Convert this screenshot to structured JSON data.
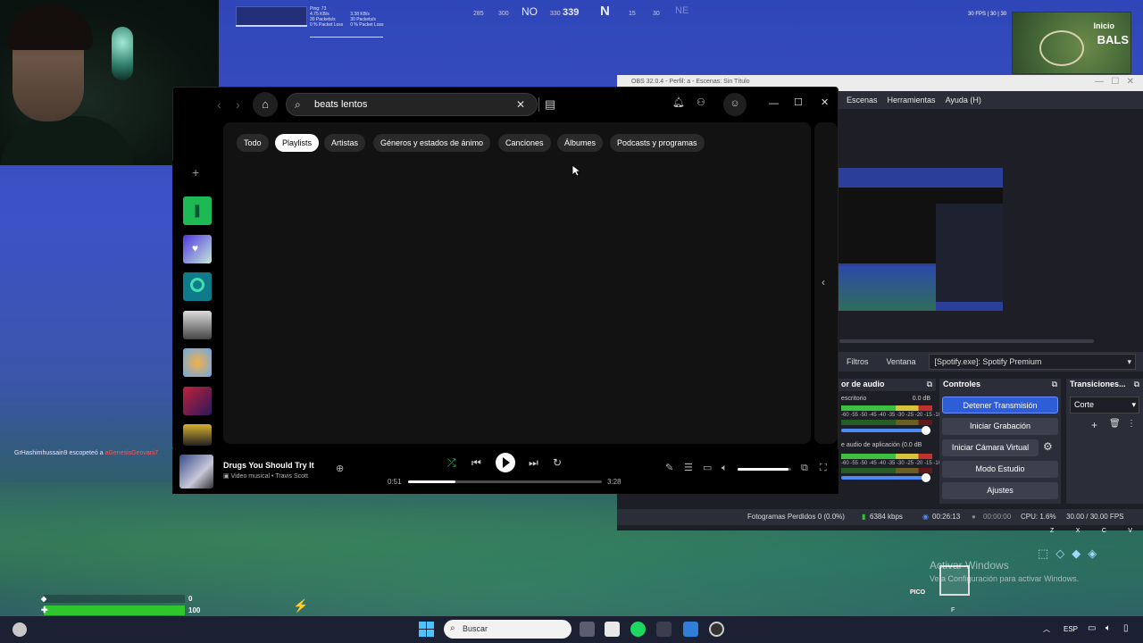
{
  "hud": {
    "net_stats": [
      "Ping: 73",
      "4.75 KB/s",
      "3.38 KB/s",
      "30 Packets/s",
      "30 Packets/s",
      "0 % Packet Loss",
      "0 % Packet Loss"
    ],
    "compass": [
      "285",
      "300",
      "NO",
      "330",
      "339",
      "N",
      "15",
      "30",
      "NE"
    ],
    "fps_corner": "30 FPS | 30 | 30",
    "minimap_label": "Inicio",
    "minimap_place": "BALS",
    "health_shield": "0",
    "health_value": "100",
    "killfeed_name": "GrHashimhussain9 escopeteó a",
    "killfeed_target": "aGenesisGeovani7",
    "pico": "PICO",
    "key_f": "F",
    "keys": [
      "Z",
      "X",
      "C",
      "V"
    ]
  },
  "obs": {
    "title": "OBS 32.0.4 - Perfil: a - Escenas: Sin Título",
    "menu": [
      "Escenas",
      "Herramientas",
      "Ayuda (H)"
    ],
    "source_tabs": [
      "Filtros",
      "Ventana"
    ],
    "source_value": "[Spotify.exe]: Spotify Premium",
    "mixer_title": "or de audio",
    "mixer_tracks": [
      {
        "name": "escritorio",
        "db": "0.0 dB"
      },
      {
        "name": "e audio de aplicación (0.0 dB",
        "db": ""
      }
    ],
    "meter_scale": "-60 -55 -50 -45 -40 -35 -30 -25 -20 -15 -10 -5 0",
    "controls_title": "Controles",
    "controls": [
      "Detener Transmisión",
      "Iniciar Grabación",
      "Iniciar Cámara Virtual",
      "Modo Estudio",
      "Ajustes"
    ],
    "transitions_title": "Transiciones...",
    "transition_value": "Corte",
    "status": {
      "dropped": "Fotogramas Perdidos 0 (0.0%)",
      "kbps": "6384 kbps",
      "stream_time": "00:26:13",
      "rec_time": "00:00:00",
      "cpu": "CPU: 1.6%",
      "fps": "30.00 / 30.00 FPS"
    }
  },
  "spotify": {
    "search_value": "beats lentos",
    "chips": [
      "Todo",
      "Playlists",
      "Artistas",
      "Géneros y estados de ánimo",
      "Canciones",
      "Álbumes",
      "Podcasts y programas"
    ],
    "active_chip": "Playlists",
    "now_playing": {
      "title": "Drugs You Should Try It",
      "subtitle": "Video musical • Travis Scott",
      "elapsed": "0:51",
      "duration": "3:28",
      "progress": 0.245,
      "volume": 0.95
    },
    "icons": [
      "back-icon",
      "forward-icon",
      "home-icon",
      "search-icon",
      "clear-icon",
      "browse-icon",
      "bell-icon",
      "friends-icon",
      "profile-icon",
      "minimize-icon",
      "maximize-icon",
      "close-icon"
    ]
  },
  "desktop": {
    "activate_title": "Activar Windows",
    "activate_sub": "Ve a Configuración para activar Windows.",
    "taskbar_search": "Buscar",
    "tray_lang": "ESP"
  },
  "colors": {
    "spotify_green": "#1ed760",
    "obs_primary": "#2e5dd8",
    "health_green": "#2ec52e"
  }
}
